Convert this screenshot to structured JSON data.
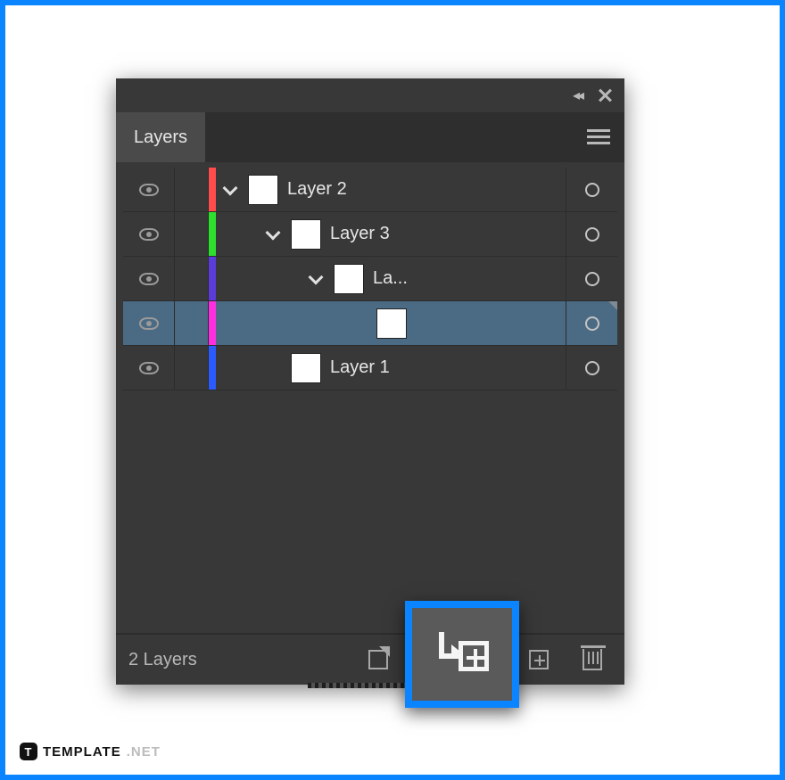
{
  "panel": {
    "tab_label": "Layers",
    "layers": [
      {
        "name": "Layer 2",
        "color": "#ff4d4d",
        "indent": 0,
        "expanded": true,
        "selected": false,
        "showThumb": true
      },
      {
        "name": "Layer 3",
        "color": "#2ee02e",
        "indent": 1,
        "expanded": true,
        "selected": false,
        "showThumb": true
      },
      {
        "name": "La...",
        "color": "#5b3bd9",
        "indent": 2,
        "expanded": true,
        "selected": false,
        "showThumb": true
      },
      {
        "name": "",
        "color": "#ff2ee0",
        "indent": 3,
        "expanded": false,
        "selected": true,
        "showThumb": true
      },
      {
        "name": "Layer 1",
        "color": "#2b5bff",
        "indent": 1,
        "expanded": false,
        "selected": false,
        "showThumb": true
      }
    ],
    "status_text": "2 Layers"
  },
  "branding": {
    "logo_letter": "T",
    "name_bold": "TEMPLATE",
    "name_dim": ".NET"
  }
}
